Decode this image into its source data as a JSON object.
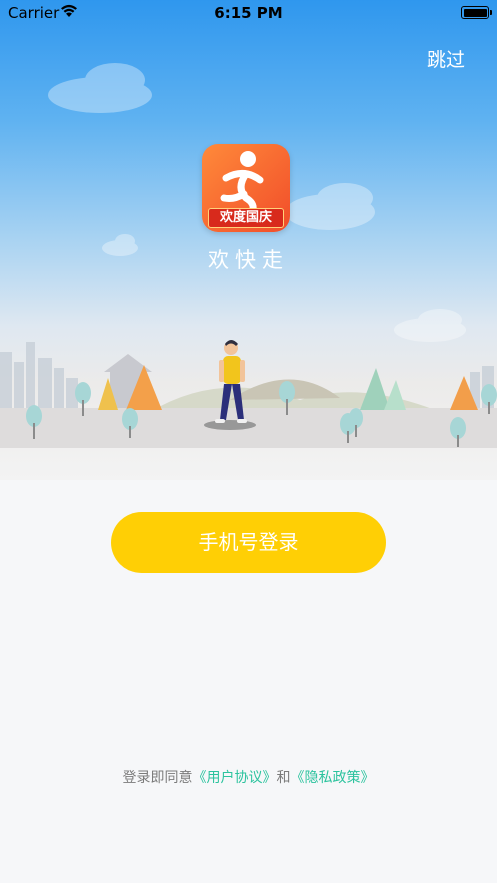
{
  "status_bar": {
    "carrier": "Carrier",
    "time": "6:15 PM"
  },
  "header": {
    "skip_label": "跳过"
  },
  "app": {
    "badge_text": "欢度国庆",
    "name": "欢快走"
  },
  "login": {
    "phone_login_label": "手机号登录"
  },
  "agreement": {
    "prefix": "登录即同意",
    "user_agreement": "《用户协议》",
    "conjunction": "和",
    "privacy_policy": "《隐私政策》"
  },
  "colors": {
    "accent_yellow": "#ffcf05",
    "link_green": "#2cc39e",
    "sky_blue": "#2f97ee"
  }
}
